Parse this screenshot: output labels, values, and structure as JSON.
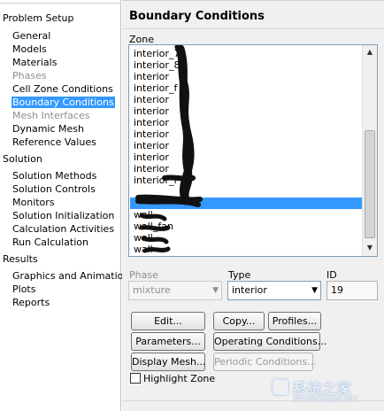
{
  "tree": {
    "groups": [
      "Problem Setup",
      "Solution",
      "Results"
    ],
    "problem_setup": [
      "General",
      "Models",
      "Materials",
      "Phases",
      "Cell Zone Conditions",
      "Boundary Conditions",
      "Mesh Interfaces",
      "Dynamic Mesh",
      "Reference Values"
    ],
    "solution": [
      "Solution Methods",
      "Solution Controls",
      "Monitors",
      "Solution Initialization",
      "Calculation Activities",
      "Run Calculation"
    ],
    "results": [
      "Graphics and Animations",
      "Plots",
      "Reports"
    ],
    "selected": "Boundary Conditions",
    "disabled": [
      "Phases",
      "Mesh Interfaces"
    ]
  },
  "panel": {
    "title": "Boundary Conditions",
    "zone_label": "Zone",
    "zones": [
      "interior_7",
      "interior_8",
      "interior",
      "interior_f",
      "interior",
      "interior",
      "interior",
      "interior",
      "interior",
      "interior",
      "interior",
      "interior_f",
      "",
      "wall",
      "wall_fan",
      "wall",
      "wall",
      "wall_fan"
    ],
    "selected_zone_index": 12,
    "phase_label": "Phase",
    "phase_value": "mixture",
    "type_label": "Type",
    "type_value": "interior",
    "id_label": "ID",
    "id_value": "19",
    "buttons": {
      "edit": "Edit...",
      "copy": "Copy...",
      "profiles": "Profiles...",
      "parameters": "Parameters...",
      "operating": "Operating Conditions...",
      "display_mesh": "Display Mesh...",
      "periodic": "Periodic Conditions..."
    },
    "highlight_zone": "Highlight Zone"
  },
  "watermark": {
    "text": "系统之家",
    "url": "XITONGZHIJIA.NET"
  },
  "colors": {
    "selection": "#3399ff",
    "panel_bg": "#f0f0f0",
    "disabled_text": "#8d8d8d"
  }
}
